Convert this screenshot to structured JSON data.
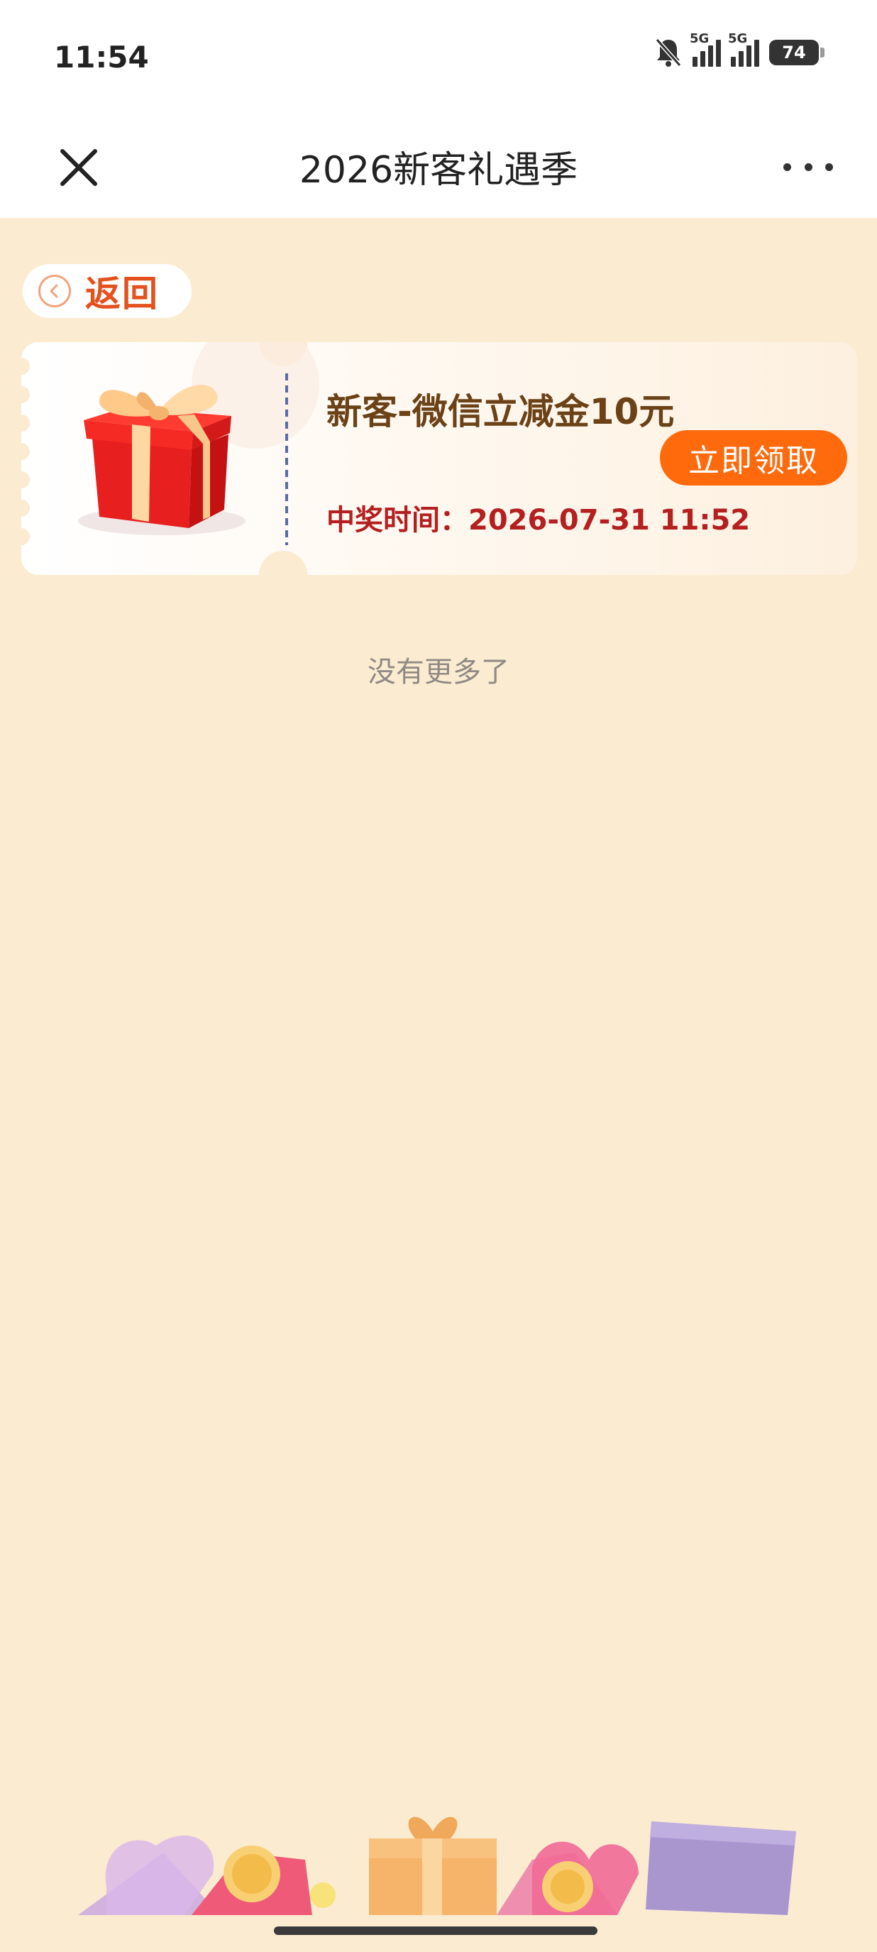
{
  "status_bar": {
    "time": "11:54",
    "network_1": "5G",
    "network_2": "5G",
    "battery": "74",
    "icons": [
      "bell-muted-icon",
      "signal-icon",
      "signal-icon",
      "battery-icon"
    ]
  },
  "header": {
    "title": "2026新客礼遇季",
    "close_icon": "close-icon",
    "more_icon": "more-icon"
  },
  "back": {
    "label": "返回",
    "icon": "chevron-left-circle-icon"
  },
  "prizes": [
    {
      "title": "新客-微信立减金10元",
      "time_label": "中奖时间：",
      "time_value": "2026-07-31 11:52",
      "button": "立即领取",
      "icon": "gift-box-icon"
    }
  ],
  "footer": {
    "no_more": "没有更多了"
  },
  "colors": {
    "page_background": "#fbebd1",
    "accent": "#ff6a0c",
    "title_brown": "#6b4218",
    "time_red": "#b41f1f",
    "back_text": "#e5511e"
  }
}
